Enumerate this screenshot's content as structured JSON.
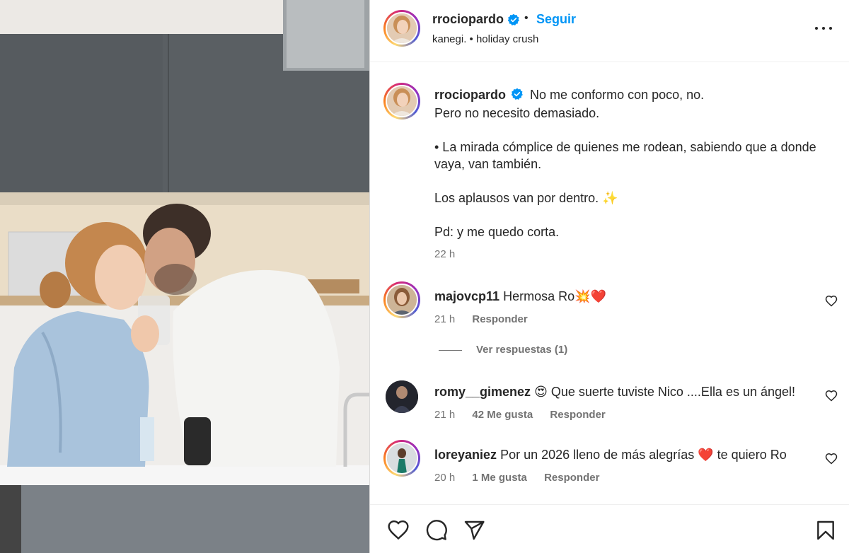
{
  "post": {
    "username": "rrociopardo",
    "follow_label": "Seguir",
    "separator": "•",
    "audio_text": "kanegi. • holiday crush"
  },
  "caption": {
    "username": "rrociopardo",
    "lines": [
      "No me conformo con poco, no.",
      "Pero no necesito demasiado.",
      "",
      "• La mirada cómplice de quienes me rodean, sabiendo que a donde",
      "vaya, van también.",
      "",
      "Los aplausos van por dentro. ✨",
      "",
      "Pd: y me quedo corta."
    ],
    "time": "22 h"
  },
  "comments": [
    {
      "username": "majovcp11",
      "text": "Hermosa Ro💥❤️",
      "time": "21 h",
      "likes": "",
      "reply_label": "Responder",
      "view_replies": "Ver respuestas (1)"
    },
    {
      "username": "romy__gimenez",
      "text": "😍 Que suerte tuviste Nico ....Ella es un ángel!",
      "time": "21 h",
      "likes": "42 Me gusta",
      "reply_label": "Responder"
    },
    {
      "username": "loreyaniez",
      "text": "Por un 2026 lleno de más alegrías ❤️ te quiero Ro",
      "time": "20 h",
      "likes": "1 Me gusta",
      "reply_label": "Responder"
    }
  ],
  "icons": {
    "verified": "verified-badge-icon",
    "more": "more-options-icon",
    "like": "heart-icon",
    "comment": "comment-bubble-icon",
    "share": "paper-plane-icon",
    "save": "bookmark-icon"
  },
  "colors": {
    "link_blue": "#0095f6",
    "verified_blue": "#0095f6",
    "text": "#262626",
    "muted": "#737373",
    "divider": "#efefef"
  }
}
